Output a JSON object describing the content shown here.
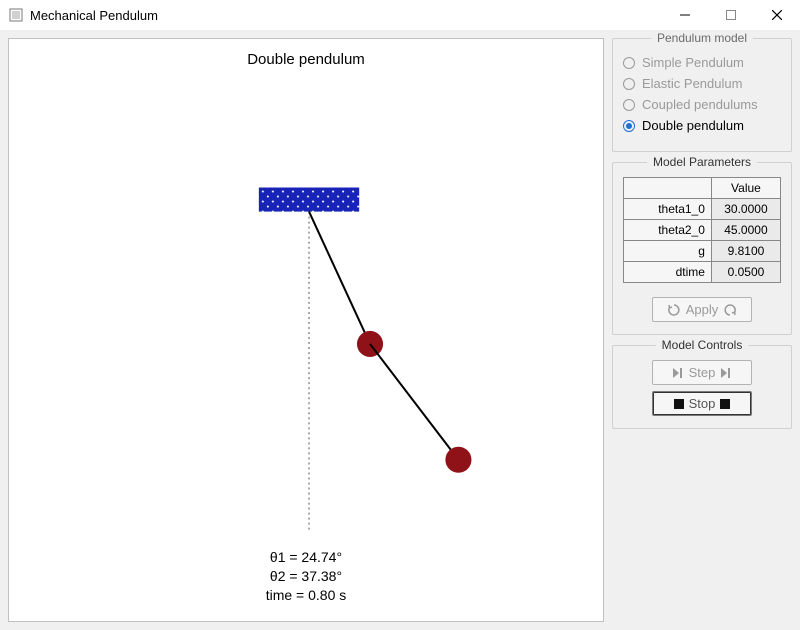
{
  "window": {
    "title": "Mechanical Pendulum"
  },
  "canvas": {
    "title": "Double pendulum",
    "readout": {
      "theta1_label": "θ1 = 24.74°",
      "theta2_label": "θ2 = 37.38°",
      "time_label": "time = 0.80 s"
    },
    "state": {
      "theta1_deg": 24.74,
      "theta2_deg": 37.38,
      "time_s": 0.8
    }
  },
  "model_group": {
    "legend": "Pendulum model",
    "options": [
      {
        "label": "Simple Pendulum",
        "selected": false
      },
      {
        "label": "Elastic Pendulum",
        "selected": false
      },
      {
        "label": "Coupled pendulums",
        "selected": false
      },
      {
        "label": "Double pendulum",
        "selected": true
      }
    ]
  },
  "params_group": {
    "legend": "Model Parameters",
    "header": {
      "value": "Value"
    },
    "rows": [
      {
        "name": "theta1_0",
        "value": "30.0000"
      },
      {
        "name": "theta2_0",
        "value": "45.0000"
      },
      {
        "name": "g",
        "value": "9.8100"
      },
      {
        "name": "dtime",
        "value": "0.0500"
      }
    ],
    "apply_label": "Apply"
  },
  "controls_group": {
    "legend": "Model Controls",
    "step_label": "Step",
    "stop_label": "Stop"
  }
}
